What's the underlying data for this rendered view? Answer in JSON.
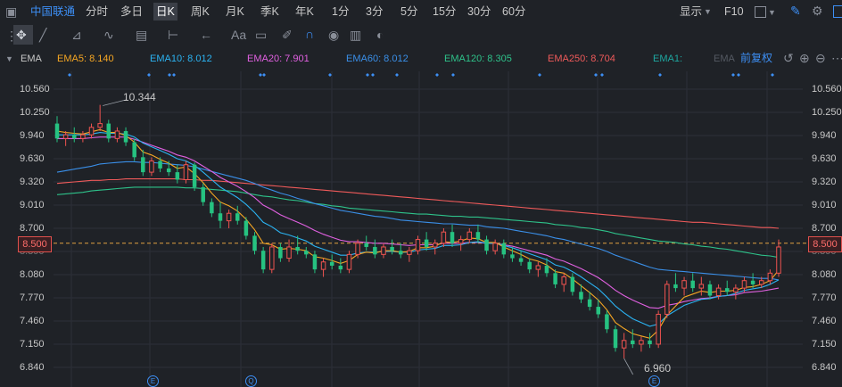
{
  "toolbar": {
    "stock_name": "中国联通",
    "periods": [
      "分时",
      "多日",
      "日K",
      "周K",
      "月K",
      "季K",
      "年K",
      "1分",
      "3分",
      "5分",
      "15分",
      "30分",
      "60分"
    ],
    "active_period": "日K",
    "display_label": "显示",
    "f10_label": "F10",
    "draw_text_icon": "Aa"
  },
  "indicator": {
    "name": "EMA",
    "adjust_label": "前复权",
    "items": [
      {
        "label": "EMA5: 8.140",
        "color": "#f5a623"
      },
      {
        "label": "EMA10: 8.012",
        "color": "#2bb3f2"
      },
      {
        "label": "EMA20: 7.901",
        "color": "#e060e0"
      },
      {
        "label": "EMA60: 8.012",
        "color": "#3a8fe8"
      },
      {
        "label": "EMA120: 8.305",
        "color": "#2ec28a"
      },
      {
        "label": "EMA250: 8.704",
        "color": "#ef5a5a"
      },
      {
        "label": "EMA1:",
        "color": "#1ea7a0"
      },
      {
        "label": "EMA",
        "color": "#555a63"
      }
    ]
  },
  "chart_data": {
    "type": "candlestick",
    "y_ticks": [
      "10.560",
      "10.250",
      "9.940",
      "9.630",
      "9.320",
      "9.010",
      "8.700",
      "8.390",
      "8.080",
      "7.770",
      "7.460",
      "7.150",
      "6.840"
    ],
    "ylim": [
      6.84,
      10.56
    ],
    "current_price": "8.500",
    "annotations": {
      "high": "10.344",
      "low": "6.960"
    },
    "event_markers": [
      "E",
      "Q",
      "E"
    ],
    "up_color": "#ef5350",
    "down_color": "#26c281",
    "ohlc": [
      [
        10.1,
        10.2,
        9.85,
        9.9
      ],
      [
        9.9,
        10.0,
        9.8,
        9.95
      ],
      [
        9.95,
        10.05,
        9.85,
        9.9
      ],
      [
        9.9,
        10.0,
        9.85,
        9.95
      ],
      [
        9.95,
        10.1,
        9.9,
        10.05
      ],
      [
        10.05,
        10.35,
        10.0,
        10.1
      ],
      [
        10.1,
        10.15,
        9.85,
        9.9
      ],
      [
        9.9,
        10.05,
        9.85,
        10.0
      ],
      [
        10.0,
        10.05,
        9.8,
        9.85
      ],
      [
        9.85,
        9.9,
        9.6,
        9.65
      ],
      [
        9.65,
        9.75,
        9.4,
        9.45
      ],
      [
        9.45,
        9.65,
        9.4,
        9.6
      ],
      [
        9.6,
        9.65,
        9.45,
        9.5
      ],
      [
        9.5,
        9.6,
        9.4,
        9.45
      ],
      [
        9.45,
        9.55,
        9.3,
        9.35
      ],
      [
        9.35,
        9.6,
        9.3,
        9.55
      ],
      [
        9.55,
        9.58,
        9.2,
        9.25
      ],
      [
        9.25,
        9.3,
        9.0,
        9.05
      ],
      [
        9.05,
        9.1,
        8.85,
        8.9
      ],
      [
        8.9,
        9.05,
        8.7,
        8.8
      ],
      [
        8.8,
        8.95,
        8.7,
        8.9
      ],
      [
        8.9,
        9.0,
        8.75,
        8.8
      ],
      [
        8.8,
        8.85,
        8.55,
        8.6
      ],
      [
        8.6,
        8.65,
        8.35,
        8.4
      ],
      [
        8.4,
        8.45,
        8.1,
        8.15
      ],
      [
        8.15,
        8.5,
        8.1,
        8.45
      ],
      [
        8.45,
        8.5,
        8.25,
        8.3
      ],
      [
        8.3,
        8.55,
        8.25,
        8.45
      ],
      [
        8.45,
        8.6,
        8.35,
        8.4
      ],
      [
        8.4,
        8.45,
        8.3,
        8.35
      ],
      [
        8.35,
        8.4,
        8.1,
        8.15
      ],
      [
        8.15,
        8.3,
        8.05,
        8.25
      ],
      [
        8.25,
        8.35,
        8.15,
        8.2
      ],
      [
        8.2,
        8.3,
        8.1,
        8.15
      ],
      [
        8.15,
        8.4,
        8.1,
        8.35
      ],
      [
        8.35,
        8.55,
        8.3,
        8.5
      ],
      [
        8.5,
        8.6,
        8.4,
        8.45
      ],
      [
        8.45,
        8.55,
        8.3,
        8.35
      ],
      [
        8.35,
        8.5,
        8.3,
        8.45
      ],
      [
        8.45,
        8.55,
        8.35,
        8.4
      ],
      [
        8.4,
        8.5,
        8.3,
        8.35
      ],
      [
        8.35,
        8.45,
        8.25,
        8.4
      ],
      [
        8.4,
        8.6,
        8.35,
        8.55
      ],
      [
        8.55,
        8.65,
        8.4,
        8.45
      ],
      [
        8.45,
        8.55,
        8.35,
        8.5
      ],
      [
        8.5,
        8.7,
        8.45,
        8.65
      ],
      [
        8.65,
        8.75,
        8.45,
        8.5
      ],
      [
        8.5,
        8.6,
        8.4,
        8.55
      ],
      [
        8.55,
        8.7,
        8.5,
        8.65
      ],
      [
        8.65,
        8.75,
        8.5,
        8.55
      ],
      [
        8.55,
        8.6,
        8.35,
        8.4
      ],
      [
        8.4,
        8.55,
        8.35,
        8.5
      ],
      [
        8.5,
        8.55,
        8.3,
        8.35
      ],
      [
        8.35,
        8.45,
        8.25,
        8.3
      ],
      [
        8.3,
        8.4,
        8.2,
        8.25
      ],
      [
        8.25,
        8.3,
        8.1,
        8.15
      ],
      [
        8.15,
        8.25,
        8.05,
        8.2
      ],
      [
        8.2,
        8.3,
        8.05,
        8.1
      ],
      [
        8.1,
        8.15,
        7.9,
        7.95
      ],
      [
        7.95,
        8.1,
        7.85,
        8.05
      ],
      [
        8.05,
        8.1,
        7.8,
        7.85
      ],
      [
        7.85,
        7.95,
        7.7,
        7.75
      ],
      [
        7.75,
        7.85,
        7.6,
        7.65
      ],
      [
        7.65,
        7.75,
        7.5,
        7.55
      ],
      [
        7.55,
        7.6,
        7.3,
        7.35
      ],
      [
        7.35,
        7.4,
        7.05,
        7.1
      ],
      [
        7.1,
        7.3,
        6.96,
        7.2
      ],
      [
        7.2,
        7.35,
        7.1,
        7.15
      ],
      [
        7.15,
        7.25,
        7.05,
        7.2
      ],
      [
        7.2,
        7.3,
        7.1,
        7.15
      ],
      [
        7.15,
        7.6,
        7.1,
        7.55
      ],
      [
        7.55,
        8.0,
        7.5,
        7.95
      ],
      [
        7.95,
        8.1,
        7.85,
        7.9
      ],
      [
        7.9,
        8.05,
        7.8,
        8.0
      ],
      [
        8.0,
        8.1,
        7.85,
        7.9
      ],
      [
        7.9,
        8.05,
        7.8,
        7.95
      ],
      [
        7.95,
        8.0,
        7.75,
        7.8
      ],
      [
        7.8,
        7.95,
        7.75,
        7.9
      ],
      [
        7.9,
        8.0,
        7.8,
        7.85
      ],
      [
        7.85,
        7.95,
        7.75,
        7.9
      ],
      [
        7.9,
        8.05,
        7.85,
        8.0
      ],
      [
        8.0,
        8.1,
        7.9,
        7.95
      ],
      [
        7.95,
        8.05,
        7.9,
        8.0
      ],
      [
        8.0,
        8.15,
        7.95,
        8.1
      ],
      [
        8.1,
        8.55,
        8.05,
        8.45
      ]
    ],
    "ema": {
      "EMA5": [
        10.0,
        9.98,
        9.97,
        9.96,
        9.99,
        10.02,
        9.98,
        9.98,
        9.94,
        9.85,
        9.72,
        9.68,
        9.62,
        9.57,
        9.5,
        9.52,
        9.43,
        9.31,
        9.17,
        9.05,
        9.0,
        8.93,
        8.82,
        8.68,
        8.5,
        8.48,
        8.42,
        8.43,
        8.42,
        8.4,
        8.32,
        8.3,
        8.27,
        8.23,
        8.27,
        8.35,
        8.38,
        8.37,
        8.4,
        8.4,
        8.38,
        8.39,
        8.44,
        8.44,
        8.46,
        8.52,
        8.51,
        8.53,
        8.57,
        8.56,
        8.51,
        8.51,
        8.45,
        8.4,
        8.35,
        8.29,
        8.26,
        8.21,
        8.12,
        8.1,
        8.02,
        7.93,
        7.84,
        7.74,
        7.61,
        7.44,
        7.36,
        7.29,
        7.26,
        7.23,
        7.34,
        7.54,
        7.66,
        7.78,
        7.82,
        7.86,
        7.84,
        7.86,
        7.86,
        7.87,
        7.91,
        7.92,
        7.95,
        8.0,
        8.14
      ],
      "EMA10": [
        9.95,
        9.95,
        9.95,
        9.95,
        9.96,
        9.98,
        9.97,
        9.97,
        9.96,
        9.92,
        9.84,
        9.79,
        9.74,
        9.69,
        9.63,
        9.6,
        9.54,
        9.45,
        9.35,
        9.25,
        9.18,
        9.11,
        9.02,
        8.91,
        8.78,
        8.72,
        8.64,
        8.61,
        8.57,
        8.53,
        8.46,
        8.42,
        8.38,
        8.34,
        8.34,
        8.37,
        8.38,
        8.38,
        8.39,
        8.39,
        8.38,
        8.38,
        8.41,
        8.42,
        8.43,
        8.47,
        8.47,
        8.48,
        8.51,
        8.52,
        8.5,
        8.5,
        8.47,
        8.44,
        8.4,
        8.36,
        8.32,
        8.28,
        8.21,
        8.18,
        8.12,
        8.05,
        7.97,
        7.89,
        7.78,
        7.66,
        7.57,
        7.49,
        7.44,
        7.39,
        7.42,
        7.53,
        7.6,
        7.67,
        7.71,
        7.75,
        7.76,
        7.79,
        7.8,
        7.83,
        7.87,
        7.89,
        7.91,
        7.95,
        8.01
      ],
      "EMA20": [
        9.9,
        9.9,
        9.9,
        9.9,
        9.91,
        9.92,
        9.92,
        9.92,
        9.92,
        9.89,
        9.85,
        9.81,
        9.77,
        9.73,
        9.68,
        9.65,
        9.6,
        9.53,
        9.46,
        9.38,
        9.32,
        9.26,
        9.19,
        9.11,
        9.01,
        8.95,
        8.88,
        8.83,
        8.78,
        8.73,
        8.67,
        8.62,
        8.58,
        8.54,
        8.52,
        8.52,
        8.51,
        8.5,
        8.5,
        8.49,
        8.48,
        8.47,
        8.48,
        8.48,
        8.48,
        8.5,
        8.5,
        8.5,
        8.51,
        8.51,
        8.5,
        8.5,
        8.48,
        8.46,
        8.43,
        8.4,
        8.37,
        8.34,
        8.29,
        8.26,
        8.21,
        8.16,
        8.1,
        8.04,
        7.96,
        7.87,
        7.8,
        7.74,
        7.69,
        7.64,
        7.63,
        7.67,
        7.69,
        7.72,
        7.74,
        7.76,
        7.77,
        7.79,
        7.8,
        7.81,
        7.84,
        7.85,
        7.86,
        7.88,
        7.9
      ],
      "EMA60": [
        9.45,
        9.47,
        9.49,
        9.51,
        9.53,
        9.56,
        9.57,
        9.58,
        9.59,
        9.59,
        9.58,
        9.58,
        9.57,
        9.56,
        9.55,
        9.54,
        9.52,
        9.49,
        9.46,
        9.43,
        9.4,
        9.37,
        9.34,
        9.3,
        9.25,
        9.21,
        9.17,
        9.14,
        9.1,
        9.07,
        9.03,
        9.0,
        8.97,
        8.94,
        8.92,
        8.9,
        8.88,
        8.86,
        8.85,
        8.83,
        8.81,
        8.8,
        8.79,
        8.78,
        8.77,
        8.76,
        8.76,
        8.75,
        8.74,
        8.74,
        8.72,
        8.71,
        8.7,
        8.68,
        8.66,
        8.64,
        8.62,
        8.6,
        8.57,
        8.55,
        8.52,
        8.49,
        8.46,
        8.43,
        8.39,
        8.34,
        8.3,
        8.26,
        8.22,
        8.18,
        8.15,
        8.14,
        8.13,
        8.12,
        8.11,
        8.1,
        8.09,
        8.08,
        8.07,
        8.06,
        8.05,
        8.04,
        8.03,
        8.03,
        8.01
      ],
      "EMA120": [
        9.15,
        9.16,
        9.17,
        9.18,
        9.2,
        9.21,
        9.22,
        9.23,
        9.24,
        9.25,
        9.25,
        9.25,
        9.25,
        9.25,
        9.25,
        9.24,
        9.24,
        9.23,
        9.22,
        9.21,
        9.2,
        9.19,
        9.17,
        9.15,
        9.13,
        9.12,
        9.1,
        9.08,
        9.07,
        9.05,
        9.03,
        9.02,
        9.0,
        8.99,
        8.97,
        8.96,
        8.95,
        8.94,
        8.93,
        8.92,
        8.91,
        8.9,
        8.89,
        8.89,
        8.88,
        8.87,
        8.86,
        8.86,
        8.85,
        8.85,
        8.84,
        8.83,
        8.82,
        8.81,
        8.8,
        8.79,
        8.78,
        8.77,
        8.75,
        8.74,
        8.73,
        8.71,
        8.7,
        8.68,
        8.66,
        8.63,
        8.61,
        8.59,
        8.57,
        8.55,
        8.53,
        8.52,
        8.51,
        8.49,
        8.48,
        8.46,
        8.45,
        8.43,
        8.42,
        8.4,
        8.38,
        8.36,
        8.34,
        8.33,
        8.31
      ],
      "EMA250": [
        9.3,
        9.31,
        9.32,
        9.33,
        9.34,
        9.34,
        9.35,
        9.35,
        9.36,
        9.36,
        9.36,
        9.36,
        9.36,
        9.36,
        9.36,
        9.35,
        9.35,
        9.34,
        9.34,
        9.33,
        9.32,
        9.31,
        9.3,
        9.29,
        9.28,
        9.27,
        9.26,
        9.25,
        9.24,
        9.23,
        9.22,
        9.21,
        9.2,
        9.19,
        9.18,
        9.17,
        9.16,
        9.15,
        9.14,
        9.13,
        9.12,
        9.11,
        9.1,
        9.09,
        9.08,
        9.07,
        9.06,
        9.05,
        9.04,
        9.03,
        9.02,
        9.01,
        9.0,
        8.99,
        8.98,
        8.97,
        8.96,
        8.95,
        8.94,
        8.93,
        8.92,
        8.91,
        8.9,
        8.89,
        8.88,
        8.87,
        8.86,
        8.85,
        8.84,
        8.83,
        8.82,
        8.81,
        8.8,
        8.79,
        8.78,
        8.78,
        8.77,
        8.76,
        8.75,
        8.74,
        8.73,
        8.72,
        8.71,
        8.71,
        8.7
      ]
    }
  }
}
